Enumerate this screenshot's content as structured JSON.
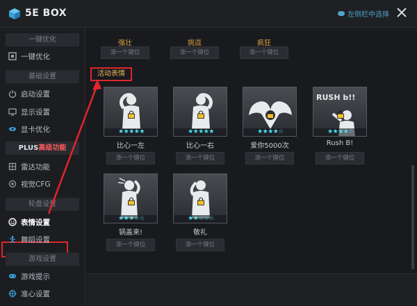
{
  "titlebar": {
    "app_title": "5E BOX",
    "app_subtitle": "",
    "toggle_label": "左侧栏中选择",
    "close_icon": "close-icon"
  },
  "sidebar": {
    "sections": [
      {
        "label": "一键优化"
      },
      {
        "label": "基础设置"
      },
      {
        "label_main": "PLUS",
        "label_accent": "高级功能"
      },
      {
        "label": "轮盘设置"
      },
      {
        "label": "游戏设置"
      }
    ],
    "items": [
      {
        "label": "一键优化",
        "icon": "optimize-icon"
      },
      {
        "label": "启动设置",
        "icon": "power-icon"
      },
      {
        "label": "显示设置",
        "icon": "monitor-icon"
      },
      {
        "label": "显卡优化",
        "icon": "gpu-icon"
      },
      {
        "label": "雷达功能",
        "icon": "radar-icon"
      },
      {
        "label": "视觉CFG",
        "icon": "cfg-icon"
      },
      {
        "label": "表情设置",
        "icon": "smile-icon",
        "active": true
      },
      {
        "label": "舞蹈设置",
        "icon": "dance-icon"
      },
      {
        "label": "游戏提示",
        "icon": "gamepad-icon"
      },
      {
        "label": "准心设置",
        "icon": "crosshair-icon"
      }
    ]
  },
  "content": {
    "top_categories": [
      {
        "label": "强壮",
        "button": "添一个键位"
      },
      {
        "label": "挑逗",
        "button": "添一个键位"
      },
      {
        "label": "疯狂",
        "button": "添一个键位"
      }
    ],
    "section_label": "活动表情",
    "cards": [
      {
        "name": "比心一左",
        "stars": "★★★★★",
        "rating": 5,
        "button": "添一个键位"
      },
      {
        "name": "比心一右",
        "stars": "★★★★★",
        "rating": 5,
        "button": "添一个键位"
      },
      {
        "name": "爱你5000次",
        "stars": "★★★★☆",
        "rating": 4,
        "button": "添一个键位"
      },
      {
        "name": "Rush B!",
        "stars": "★★★★☆",
        "rating": 4,
        "button": "添一个键位",
        "art_text": "RUSH b!!"
      },
      {
        "name": "锅盖来!",
        "stars": "★★★☆☆",
        "rating": 3,
        "button": "添一个键位"
      },
      {
        "name": "敬礼",
        "stars": "★★☆☆☆",
        "rating": 2,
        "button": "添一个键位"
      }
    ]
  },
  "colors": {
    "accent_red": "#e0262c",
    "accent_gold": "#d9a23f",
    "star_cyan": "#4de1f2",
    "background": "#1a1b1f"
  }
}
